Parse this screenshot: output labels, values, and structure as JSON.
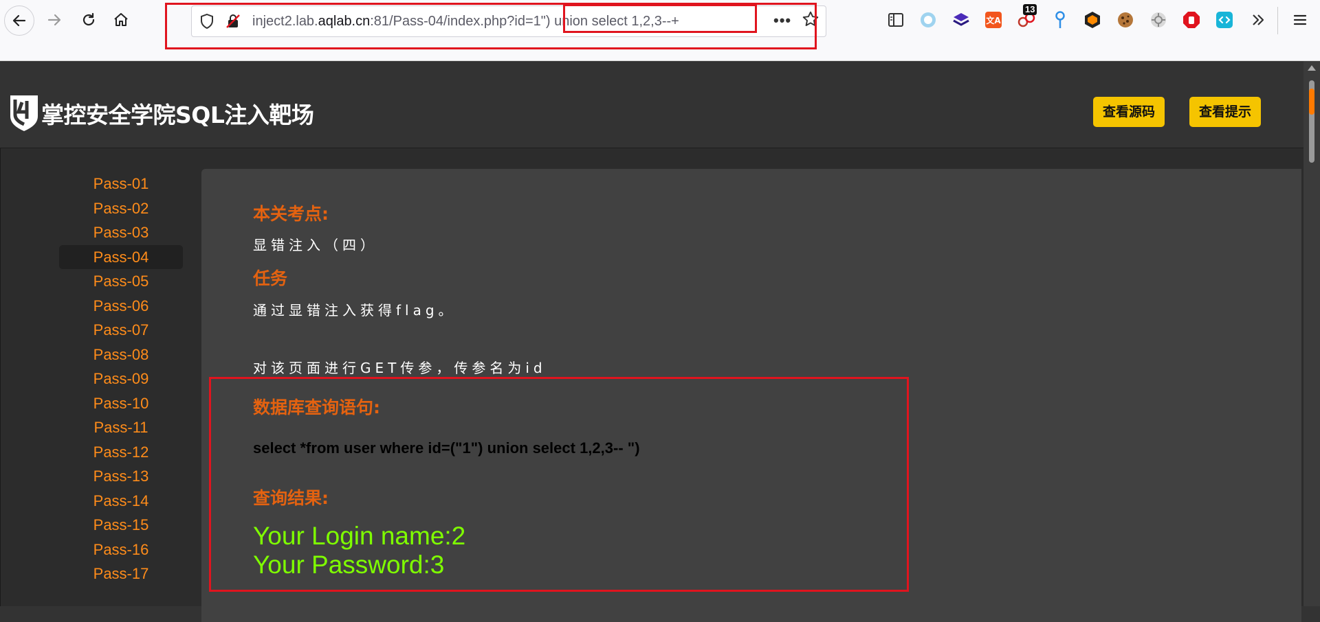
{
  "browser": {
    "url_prefix": "inject2.lab.",
    "url_domain": "aqlab.cn",
    "url_suffix": ":81/Pass-04/index.php?id=1\") union select 1,2,3--+",
    "overflow_label": "•••",
    "ext_badge_count": "13"
  },
  "header": {
    "site_title": "掌控安全学院SQL注入靶场",
    "btn_source": "查看源码",
    "btn_hint": "查看提示"
  },
  "sidebar": {
    "items": [
      {
        "label": "Pass-01",
        "active": false
      },
      {
        "label": "Pass-02",
        "active": false
      },
      {
        "label": "Pass-03",
        "active": false
      },
      {
        "label": "Pass-04",
        "active": true
      },
      {
        "label": "Pass-05",
        "active": false
      },
      {
        "label": "Pass-06",
        "active": false
      },
      {
        "label": "Pass-07",
        "active": false
      },
      {
        "label": "Pass-08",
        "active": false
      },
      {
        "label": "Pass-09",
        "active": false
      },
      {
        "label": "Pass-10",
        "active": false
      },
      {
        "label": "Pass-11",
        "active": false
      },
      {
        "label": "Pass-12",
        "active": false
      },
      {
        "label": "Pass-13",
        "active": false
      },
      {
        "label": "Pass-14",
        "active": false
      },
      {
        "label": "Pass-15",
        "active": false
      },
      {
        "label": "Pass-16",
        "active": false
      },
      {
        "label": "Pass-17",
        "active": false
      }
    ]
  },
  "content": {
    "key_point_heading": "本关考点:",
    "key_point_text": "显错注入（四）",
    "task_heading": "任务",
    "task_line1": "通过显错注入获得flag。",
    "task_line2": "对该页面进行GET传参，传参名为id",
    "query_heading": "数据库查询语句:",
    "query_sql": "select *from user where id=(\"1\") union select 1,2,3-- \")",
    "result_heading": "查询结果:",
    "result_login": "Your Login name:2",
    "result_password": "Your Password:3"
  },
  "colors": {
    "accent_orange": "#e46210",
    "link_orange": "#ff8c1a",
    "button_yellow": "#f5c400",
    "result_green": "#7fff00",
    "annotation_red": "#e0141e"
  }
}
